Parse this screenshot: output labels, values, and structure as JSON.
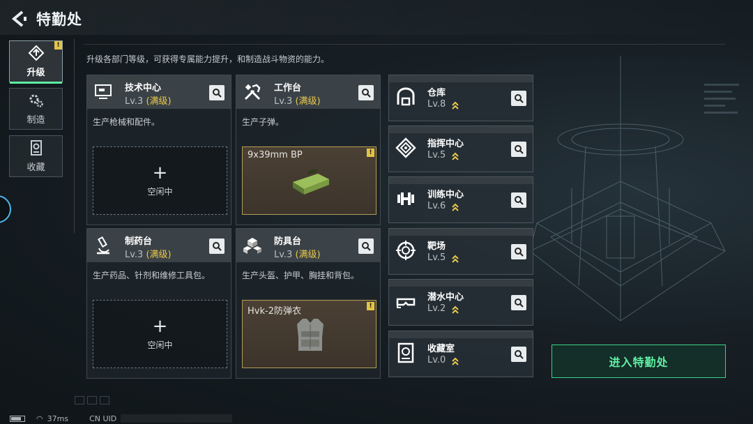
{
  "header": {
    "title": "特勤处"
  },
  "side_tabs": [
    {
      "label": "升级",
      "icon": "upgrade-icon",
      "active": true,
      "badge": "!"
    },
    {
      "label": "制造",
      "icon": "gears-icon",
      "active": false
    },
    {
      "label": "收藏",
      "icon": "collection-icon",
      "active": false
    }
  ],
  "description": "升级各部门等级，可获得专属能力提升，和制造战斗物资的能力。",
  "facilities": [
    {
      "name": "技术中心",
      "level": "Lv.3",
      "status": "(满级)",
      "sub": "生产枪械和配件。",
      "slot_type": "empty",
      "slot_plus": "+",
      "slot_text": "空闲中",
      "icon": "computer-icon"
    },
    {
      "name": "工作台",
      "level": "Lv.3",
      "status": "(满级)",
      "sub": "生产子弹。",
      "slot_type": "item",
      "slot_text": "9x39mm BP",
      "badge": "!",
      "icon": "tools-icon"
    },
    {
      "name": "制药台",
      "level": "Lv.3",
      "status": "(满级)",
      "sub": "生产药品、针剂和维修工具包。",
      "slot_type": "empty",
      "slot_plus": "+",
      "slot_text": "空闲中",
      "icon": "microscope-icon"
    },
    {
      "name": "防具台",
      "level": "Lv.3",
      "status": "(满级)",
      "sub": "生产头盔、护甲、胸挂和背包。",
      "slot_type": "item",
      "slot_text": "Hvk-2防弹衣",
      "badge": "!",
      "icon": "armor-boxes-icon"
    }
  ],
  "departments": [
    {
      "name": "仓库",
      "level": "Lv.8",
      "icon": "warehouse-icon"
    },
    {
      "name": "指挥中心",
      "level": "Lv.5",
      "icon": "command-icon"
    },
    {
      "name": "训练中心",
      "level": "Lv.6",
      "icon": "dumbbell-icon"
    },
    {
      "name": "靶场",
      "level": "Lv.5",
      "icon": "target-icon"
    },
    {
      "name": "潜水中心",
      "level": "Lv.2",
      "icon": "dive-mask-icon"
    },
    {
      "name": "收藏室",
      "level": "Lv.0",
      "icon": "vault-icon"
    }
  ],
  "enter_button": "进入特勤处",
  "status_bar": {
    "ping": "37ms",
    "uid_label": "CN UID"
  },
  "colors": {
    "accent_green": "#5ff0a3",
    "max_yellow": "#e8c84b",
    "item_border": "#b59d55"
  }
}
